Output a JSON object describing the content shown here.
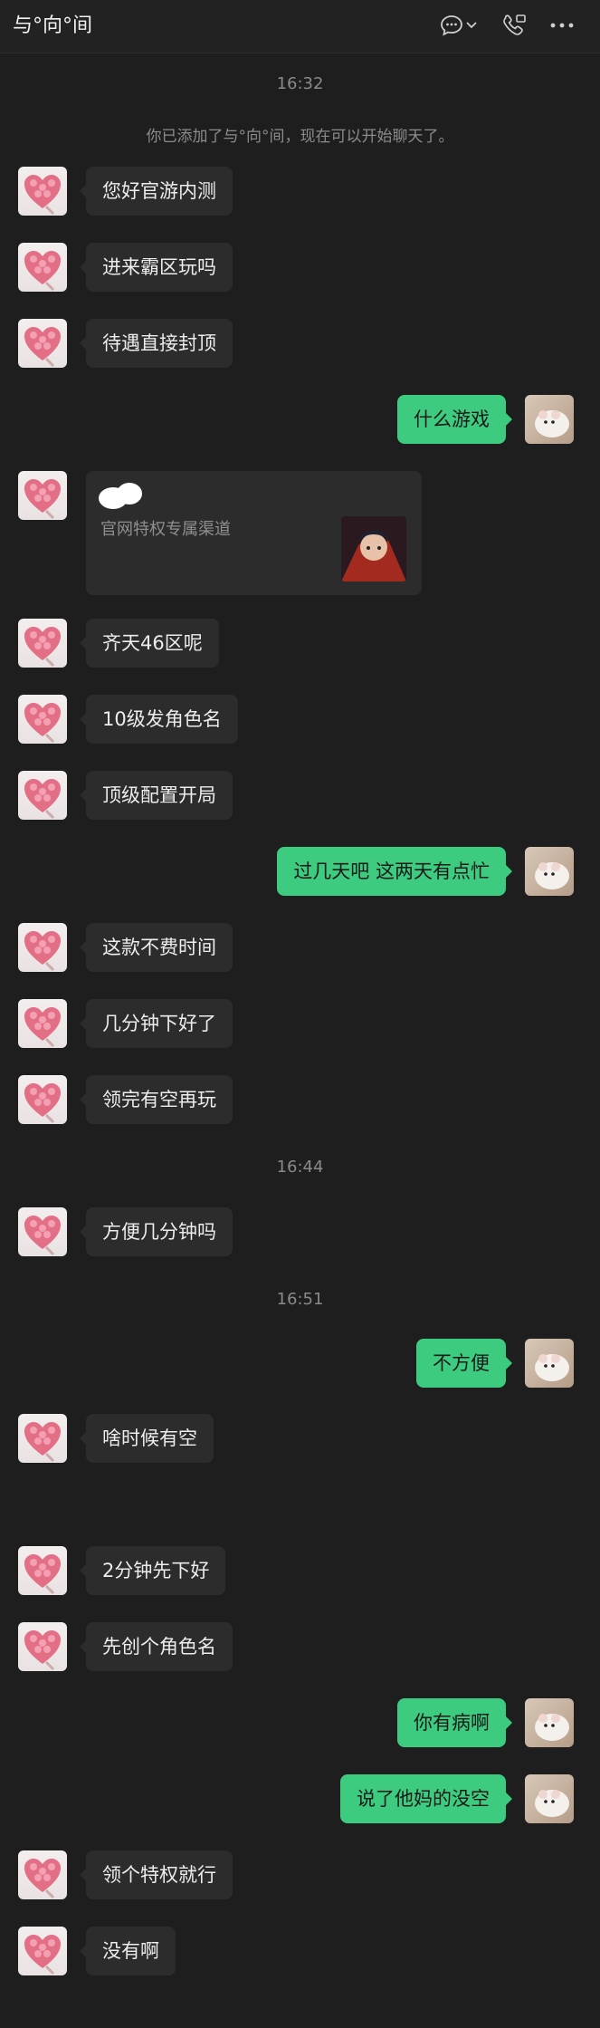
{
  "header": {
    "title": "与°向°间",
    "icons": [
      "chat-bubble-icon",
      "chevron-down-icon",
      "phone-icon",
      "more-icon"
    ]
  },
  "timestamps": [
    "16:32",
    "16:44",
    "16:51"
  ],
  "system_notice": "你已添加了与°向°间，现在可以开始聊天了。",
  "messages": [
    {
      "side": "left",
      "text": "您好官游内测"
    },
    {
      "side": "left",
      "text": "进来霸区玩吗"
    },
    {
      "side": "left",
      "text": "待遇直接封顶"
    },
    {
      "side": "right",
      "text": "什么游戏"
    },
    {
      "side": "left",
      "text": "齐天46区呢"
    },
    {
      "side": "left",
      "text": "10级发角色名"
    },
    {
      "side": "left",
      "text": "顶级配置开局"
    },
    {
      "side": "right",
      "text": "过几天吧  这两天有点忙"
    },
    {
      "side": "left",
      "text": "这款不费时间"
    },
    {
      "side": "left",
      "text": "几分钟下好了"
    },
    {
      "side": "left",
      "text": "领完有空再玩"
    },
    {
      "side": "left",
      "text": "方便几分钟吗"
    },
    {
      "side": "right",
      "text": "不方便"
    },
    {
      "side": "left",
      "text": "啥时候有空"
    },
    {
      "side": "left",
      "text": "2分钟先下好"
    },
    {
      "side": "left",
      "text": "先创个角色名"
    },
    {
      "side": "right",
      "text": "你有病啊"
    },
    {
      "side": "right",
      "text": "说了他妈的没空"
    },
    {
      "side": "left",
      "text": "领个特权就行"
    },
    {
      "side": "left",
      "text": "没有啊"
    }
  ],
  "share_card": {
    "subtitle": "官网特权专属渠道"
  },
  "colors": {
    "background": "#1e1e1e",
    "incoming_bubble": "#2c2c2c",
    "outgoing_bubble": "#3ccb7f"
  }
}
